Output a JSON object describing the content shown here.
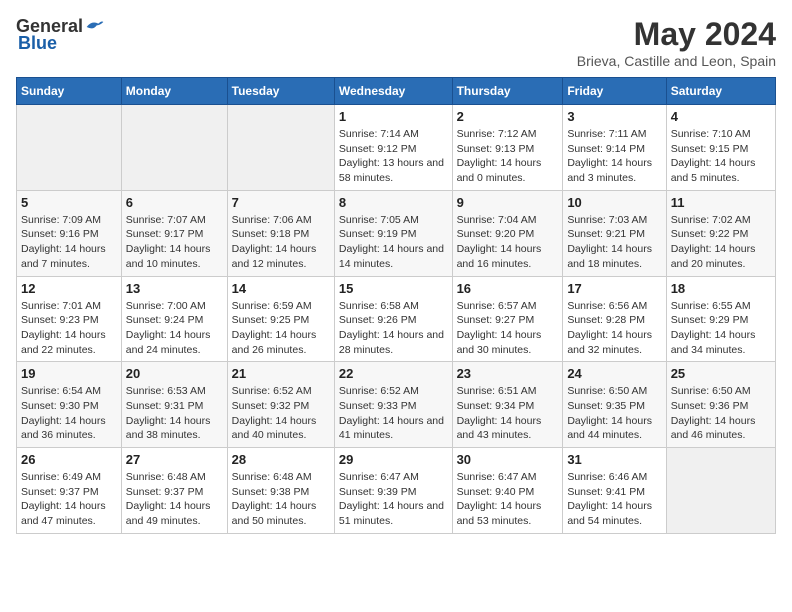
{
  "logo": {
    "general": "General",
    "blue": "Blue"
  },
  "title": "May 2024",
  "subtitle": "Brieva, Castille and Leon, Spain",
  "days_of_week": [
    "Sunday",
    "Monday",
    "Tuesday",
    "Wednesday",
    "Thursday",
    "Friday",
    "Saturday"
  ],
  "weeks": [
    [
      {
        "day": "",
        "empty": true
      },
      {
        "day": "",
        "empty": true
      },
      {
        "day": "",
        "empty": true
      },
      {
        "day": "1",
        "sunrise": "Sunrise: 7:14 AM",
        "sunset": "Sunset: 9:12 PM",
        "daylight": "Daylight: 13 hours and 58 minutes."
      },
      {
        "day": "2",
        "sunrise": "Sunrise: 7:12 AM",
        "sunset": "Sunset: 9:13 PM",
        "daylight": "Daylight: 14 hours and 0 minutes."
      },
      {
        "day": "3",
        "sunrise": "Sunrise: 7:11 AM",
        "sunset": "Sunset: 9:14 PM",
        "daylight": "Daylight: 14 hours and 3 minutes."
      },
      {
        "day": "4",
        "sunrise": "Sunrise: 7:10 AM",
        "sunset": "Sunset: 9:15 PM",
        "daylight": "Daylight: 14 hours and 5 minutes."
      }
    ],
    [
      {
        "day": "5",
        "sunrise": "Sunrise: 7:09 AM",
        "sunset": "Sunset: 9:16 PM",
        "daylight": "Daylight: 14 hours and 7 minutes."
      },
      {
        "day": "6",
        "sunrise": "Sunrise: 7:07 AM",
        "sunset": "Sunset: 9:17 PM",
        "daylight": "Daylight: 14 hours and 10 minutes."
      },
      {
        "day": "7",
        "sunrise": "Sunrise: 7:06 AM",
        "sunset": "Sunset: 9:18 PM",
        "daylight": "Daylight: 14 hours and 12 minutes."
      },
      {
        "day": "8",
        "sunrise": "Sunrise: 7:05 AM",
        "sunset": "Sunset: 9:19 PM",
        "daylight": "Daylight: 14 hours and 14 minutes."
      },
      {
        "day": "9",
        "sunrise": "Sunrise: 7:04 AM",
        "sunset": "Sunset: 9:20 PM",
        "daylight": "Daylight: 14 hours and 16 minutes."
      },
      {
        "day": "10",
        "sunrise": "Sunrise: 7:03 AM",
        "sunset": "Sunset: 9:21 PM",
        "daylight": "Daylight: 14 hours and 18 minutes."
      },
      {
        "day": "11",
        "sunrise": "Sunrise: 7:02 AM",
        "sunset": "Sunset: 9:22 PM",
        "daylight": "Daylight: 14 hours and 20 minutes."
      }
    ],
    [
      {
        "day": "12",
        "sunrise": "Sunrise: 7:01 AM",
        "sunset": "Sunset: 9:23 PM",
        "daylight": "Daylight: 14 hours and 22 minutes."
      },
      {
        "day": "13",
        "sunrise": "Sunrise: 7:00 AM",
        "sunset": "Sunset: 9:24 PM",
        "daylight": "Daylight: 14 hours and 24 minutes."
      },
      {
        "day": "14",
        "sunrise": "Sunrise: 6:59 AM",
        "sunset": "Sunset: 9:25 PM",
        "daylight": "Daylight: 14 hours and 26 minutes."
      },
      {
        "day": "15",
        "sunrise": "Sunrise: 6:58 AM",
        "sunset": "Sunset: 9:26 PM",
        "daylight": "Daylight: 14 hours and 28 minutes."
      },
      {
        "day": "16",
        "sunrise": "Sunrise: 6:57 AM",
        "sunset": "Sunset: 9:27 PM",
        "daylight": "Daylight: 14 hours and 30 minutes."
      },
      {
        "day": "17",
        "sunrise": "Sunrise: 6:56 AM",
        "sunset": "Sunset: 9:28 PM",
        "daylight": "Daylight: 14 hours and 32 minutes."
      },
      {
        "day": "18",
        "sunrise": "Sunrise: 6:55 AM",
        "sunset": "Sunset: 9:29 PM",
        "daylight": "Daylight: 14 hours and 34 minutes."
      }
    ],
    [
      {
        "day": "19",
        "sunrise": "Sunrise: 6:54 AM",
        "sunset": "Sunset: 9:30 PM",
        "daylight": "Daylight: 14 hours and 36 minutes."
      },
      {
        "day": "20",
        "sunrise": "Sunrise: 6:53 AM",
        "sunset": "Sunset: 9:31 PM",
        "daylight": "Daylight: 14 hours and 38 minutes."
      },
      {
        "day": "21",
        "sunrise": "Sunrise: 6:52 AM",
        "sunset": "Sunset: 9:32 PM",
        "daylight": "Daylight: 14 hours and 40 minutes."
      },
      {
        "day": "22",
        "sunrise": "Sunrise: 6:52 AM",
        "sunset": "Sunset: 9:33 PM",
        "daylight": "Daylight: 14 hours and 41 minutes."
      },
      {
        "day": "23",
        "sunrise": "Sunrise: 6:51 AM",
        "sunset": "Sunset: 9:34 PM",
        "daylight": "Daylight: 14 hours and 43 minutes."
      },
      {
        "day": "24",
        "sunrise": "Sunrise: 6:50 AM",
        "sunset": "Sunset: 9:35 PM",
        "daylight": "Daylight: 14 hours and 44 minutes."
      },
      {
        "day": "25",
        "sunrise": "Sunrise: 6:50 AM",
        "sunset": "Sunset: 9:36 PM",
        "daylight": "Daylight: 14 hours and 46 minutes."
      }
    ],
    [
      {
        "day": "26",
        "sunrise": "Sunrise: 6:49 AM",
        "sunset": "Sunset: 9:37 PM",
        "daylight": "Daylight: 14 hours and 47 minutes."
      },
      {
        "day": "27",
        "sunrise": "Sunrise: 6:48 AM",
        "sunset": "Sunset: 9:37 PM",
        "daylight": "Daylight: 14 hours and 49 minutes."
      },
      {
        "day": "28",
        "sunrise": "Sunrise: 6:48 AM",
        "sunset": "Sunset: 9:38 PM",
        "daylight": "Daylight: 14 hours and 50 minutes."
      },
      {
        "day": "29",
        "sunrise": "Sunrise: 6:47 AM",
        "sunset": "Sunset: 9:39 PM",
        "daylight": "Daylight: 14 hours and 51 minutes."
      },
      {
        "day": "30",
        "sunrise": "Sunrise: 6:47 AM",
        "sunset": "Sunset: 9:40 PM",
        "daylight": "Daylight: 14 hours and 53 minutes."
      },
      {
        "day": "31",
        "sunrise": "Sunrise: 6:46 AM",
        "sunset": "Sunset: 9:41 PM",
        "daylight": "Daylight: 14 hours and 54 minutes."
      },
      {
        "day": "",
        "empty": true
      }
    ]
  ]
}
